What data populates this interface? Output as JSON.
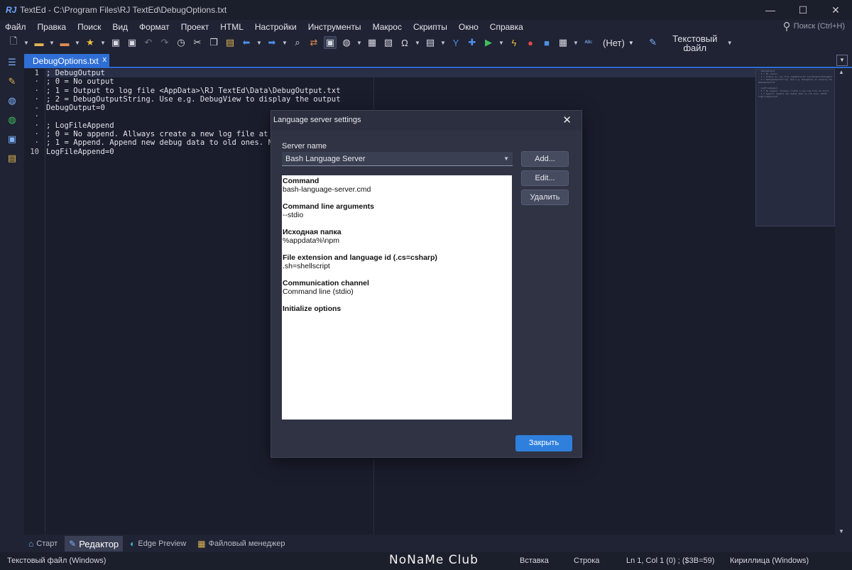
{
  "window": {
    "title": "TextEd - C:\\Program Files\\RJ TextEd\\DebugOptions.txt",
    "logo": "RJ",
    "minimize": "—",
    "maximize": "☐",
    "close": "✕"
  },
  "menu": {
    "items": [
      "Файл",
      "Правка",
      "Поиск",
      "Вид",
      "Формат",
      "Проект",
      "HTML",
      "Настройки",
      "Инструменты",
      "Макрос",
      "Скрипты",
      "Окно",
      "Справка"
    ],
    "search_placeholder": "Поиск (Ctrl+H)"
  },
  "toolbar": {
    "highlighter": "(Нет)",
    "file_type": "Текстовый файл"
  },
  "tabs": {
    "document": "DebugOptions.txt",
    "close_glyph": "x"
  },
  "editor": {
    "line_numbers": [
      "1",
      "·",
      "·",
      "·",
      "-",
      "·",
      "·",
      "·",
      "·",
      "10"
    ],
    "lines": [
      "; DebugOutput",
      "; 0 = No output",
      "; 1 = Output to log file <AppData>\\RJ TextEd\\Data\\DebugOutput.txt",
      "; 2 = DebugOutputString. Use e.g. DebugView to display the output",
      "DebugOutput=0",
      "",
      "; LogFileAppend",
      "; 0 = No append. Allways create a new log file at start",
      "; 1 = Append. Append new debug data to old ones. NOTE!",
      "LogFileAppend=0"
    ]
  },
  "dialog": {
    "title": "Language server settings",
    "server_name_label": "Server name",
    "server_name_value": "Bash Language Server",
    "buttons": {
      "add": "Add...",
      "edit": "Edit...",
      "delete": "Удалить",
      "close": "Закрыть"
    },
    "details": [
      {
        "label": "Command",
        "value": "bash-language-server.cmd"
      },
      {
        "label": "Command line arguments",
        "value": "--stdio"
      },
      {
        "label": "Исходная папка",
        "value": "%appdata%\\npm"
      },
      {
        "label": "File extension and language id (.cs=csharp)",
        "value": ".sh=shellscript"
      },
      {
        "label": "Communication channel",
        "value": "Command line (stdio)"
      },
      {
        "label": "Initialize options",
        "value": ""
      }
    ]
  },
  "bottom_tabs": [
    "Старт",
    "Редактор",
    "Edge Preview",
    "Файловый менеджер"
  ],
  "status": {
    "file_type": "Текстовый файл (Windows)",
    "watermark": "NoNaMe Club",
    "mode": "Вставка",
    "line_mode": "Строка",
    "position": "Ln 1, Col 1 (0) ; ($3B=59)",
    "encoding": "Кириллица (Windows)"
  }
}
